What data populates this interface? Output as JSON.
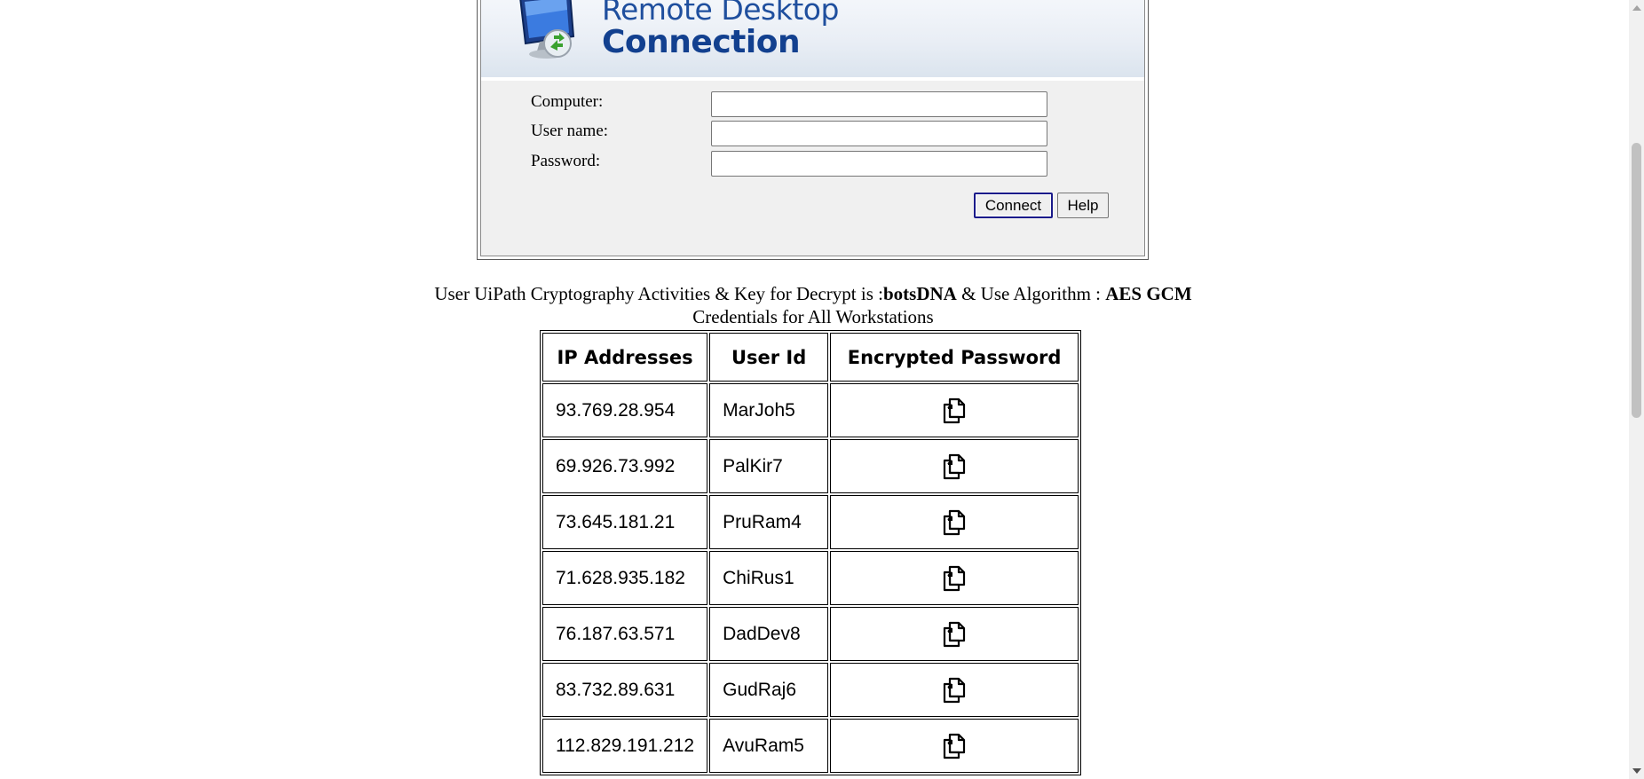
{
  "rdp": {
    "title_line1": "Remote Desktop",
    "title_line2": "Connection",
    "computer_label": "Computer:",
    "username_label": "User name:",
    "password_label": "Password:",
    "computer_value": "",
    "username_value": "",
    "password_value": "",
    "connect_label": "Connect",
    "help_label": "Help",
    "logo_icon": "remote-desktop-monitor-icon"
  },
  "info": {
    "line1_prefix": "User UiPath Cryptography Activities & Key for Decrypt is :",
    "key": "botsDNA",
    "line1_mid": " & Use Algorithm : ",
    "algorithm": "AES GCM",
    "line2": "Credentials for All Workstations"
  },
  "table": {
    "headers": [
      "IP Addresses",
      "User Id",
      "Encrypted Password"
    ],
    "copy_icon": "copy-icon",
    "rows": [
      {
        "ip": "93.769.28.954",
        "user": "MarJoh5"
      },
      {
        "ip": "69.926.73.992",
        "user": "PalKir7"
      },
      {
        "ip": "73.645.181.21",
        "user": "PruRam4"
      },
      {
        "ip": "71.628.935.182",
        "user": "ChiRus1"
      },
      {
        "ip": "76.187.63.571",
        "user": "DadDev8"
      },
      {
        "ip": "83.732.89.631",
        "user": "GudRaj6"
      },
      {
        "ip": "112.829.191.212",
        "user": "AvuRam5"
      }
    ]
  },
  "colors": {
    "brand_blue": "#1f4f9e",
    "form_bg": "#f0f0f0"
  }
}
